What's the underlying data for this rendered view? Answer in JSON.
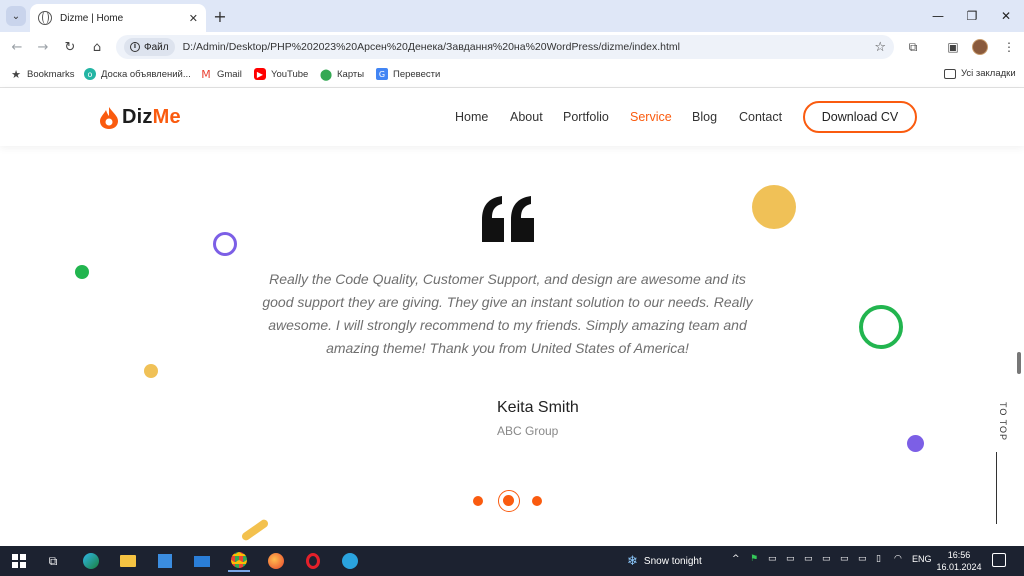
{
  "browser": {
    "tab_title": "Dizme | Home",
    "site_info_label": "Файл",
    "url": "D:/Admin/Desktop/PHP%202023%20Арсен%20Денека/Завдання%20на%20WordPress/dizme/index.html",
    "bookmarks": [
      {
        "label": "Bookmarks",
        "icon": "star-icon"
      },
      {
        "label": "Доска объявлений...",
        "icon": "olx-icon"
      },
      {
        "label": "Gmail",
        "icon": "gmail-icon"
      },
      {
        "label": "YouTube",
        "icon": "youtube-icon"
      },
      {
        "label": "Карты",
        "icon": "maps-icon"
      },
      {
        "label": "Перевести",
        "icon": "translate-icon"
      }
    ],
    "all_bookmarks_label": "Усі закладки"
  },
  "site": {
    "logo_text_main": "Diz",
    "logo_text_accent": "Me",
    "nav": [
      {
        "label": "Home"
      },
      {
        "label": "About"
      },
      {
        "label": "Portfolio"
      },
      {
        "label": "Service",
        "active": true
      },
      {
        "label": "Blog"
      },
      {
        "label": "Contact"
      }
    ],
    "download_cv": "Download CV",
    "accent_color": "#fa5b0f"
  },
  "testimonial": {
    "quote": "Really the Code Quality, Customer Support, and design are awesome and its good support they are giving. They give an instant solution to our needs. Really awesome. I will strongly recommend to my friends. Simply amazing team and amazing theme! Thank you from United States of America!",
    "author": "Keita Smith",
    "company": "ABC Group",
    "slide_count": 3,
    "active_slide": 2
  },
  "totop_label": "TO TOP",
  "taskbar": {
    "weather": "Snow tonight",
    "language": "ENG",
    "time": "16:56",
    "date": "16.01.2024"
  }
}
